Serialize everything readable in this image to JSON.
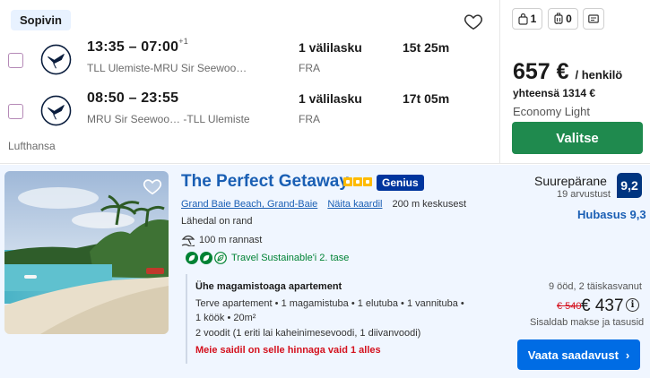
{
  "flight": {
    "badge": "Sopivin",
    "legs": [
      {
        "times": "13:35 – 07:00",
        "day_offset": "+1",
        "route": "TLL Ulemiste-MRU Sir Seewoo…",
        "stops": "1 välilasku",
        "stop_city": "FRA",
        "duration": "15t 25m"
      },
      {
        "times": "08:50 – 23:55",
        "day_offset": "",
        "route": "MRU Sir Seewoo… -TLL Ulemiste",
        "stops": "1 välilasku",
        "stop_city": "FRA",
        "duration": "17t 05m"
      }
    ],
    "airline": "Lufthansa",
    "bags": {
      "personal": "1",
      "cabin": "0"
    },
    "price": "657 €",
    "per_person": "/ henkilö",
    "total": "yhteensä 1314 €",
    "fare_class": "Economy Light",
    "select_label": "Valitse"
  },
  "hotel": {
    "name": "The Perfect Getaway",
    "star_count": 3,
    "genius_label": "Genius",
    "location": "Grand Baie Beach, Grand-Baie",
    "show_map": "Näita kaardil",
    "distance_center": "200 m keskusest",
    "beach_near": "Lähedal on rand",
    "beach_distance": "100 m rannast",
    "sustainable": "Travel Sustainable'i 2. tase",
    "room_title": "Ühe magamistoaga apartement",
    "room_line1": "Terve apartement • 1 magamistuba • 1 elutuba • 1 vannituba •",
    "room_line2": "1 köök • 20m²",
    "room_line3": "2 voodit (1 eriti lai kaheinimesevoodi, 1 diivanvoodi)",
    "room_warning": "Meie saidil on selle hinnaga vaid 1 alles",
    "rating_word": "Suurepärane",
    "review_count": "19 arvustust",
    "score": "9,2",
    "location_score": "Hubasus 9,3",
    "stay_info": "9 ööd, 2 täiskasvanut",
    "old_price": "€ 540",
    "new_price": "€ 437",
    "taxes": "Sisaldab makse ja tasusid",
    "availability_label": "Vaata saadavust"
  },
  "colors": {
    "brand_blue": "#1a5fb4",
    "select_green": "#1f8a4e",
    "genius_navy": "#00359e",
    "cta_blue": "#006ce4",
    "warning_red": "#d4111e"
  }
}
